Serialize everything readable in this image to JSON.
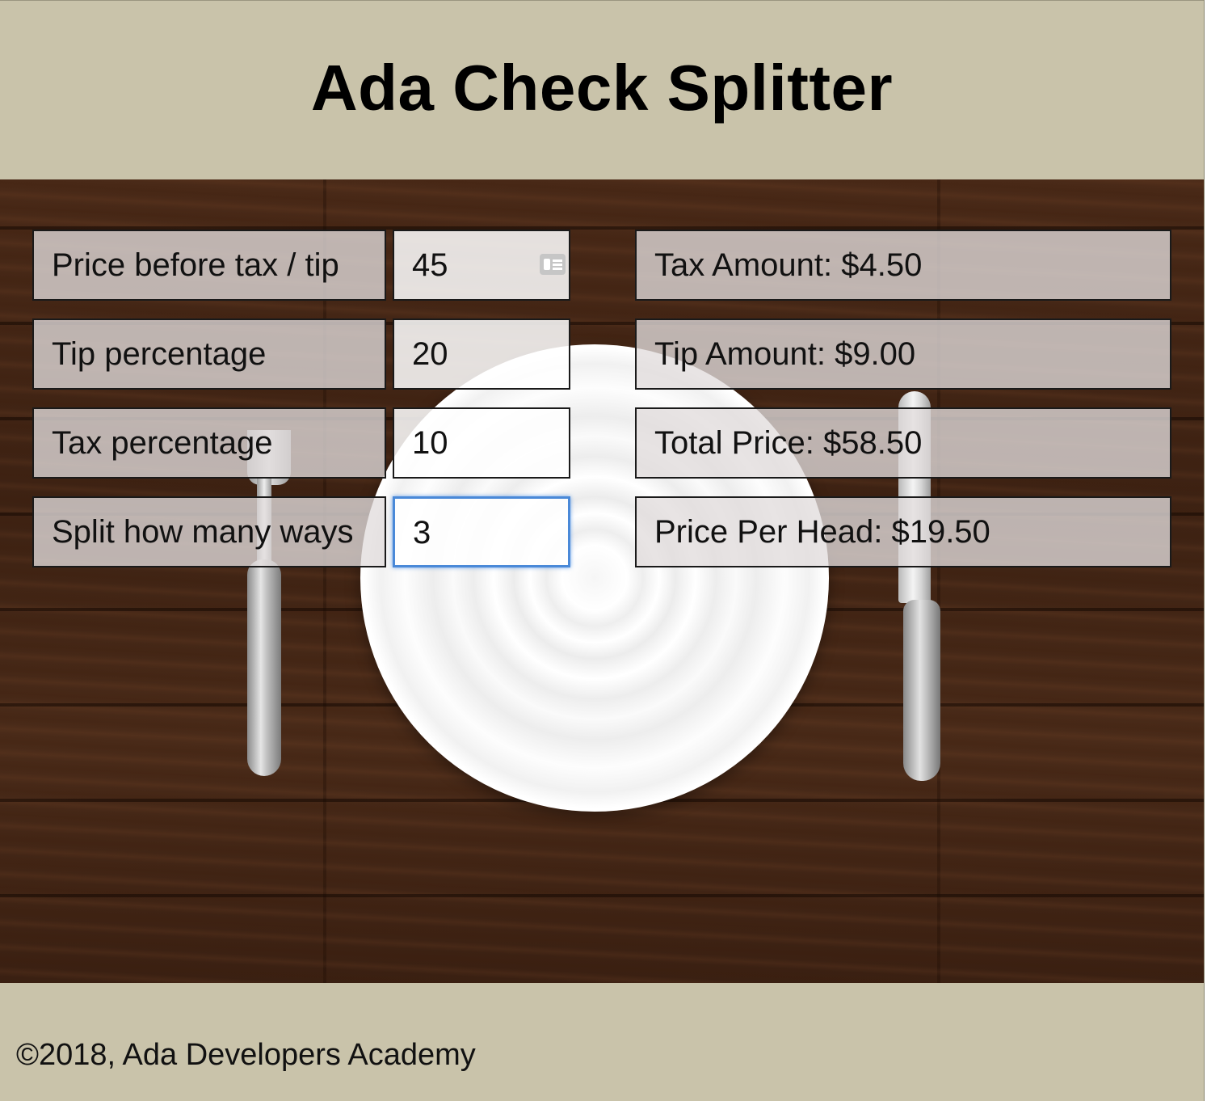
{
  "header": {
    "title": "Ada Check Splitter"
  },
  "form": {
    "price_label": "Price before tax / tip",
    "price_value": "45",
    "tip_label": "Tip percentage",
    "tip_value": "20",
    "tax_label": "Tax percentage",
    "tax_value": "10",
    "split_label": "Split how many ways",
    "split_value": "3"
  },
  "results": {
    "tax_amount": "Tax Amount: $4.50",
    "tip_amount": "Tip Amount: $9.00",
    "total_price": "Total Price: $58.50",
    "price_per_head": "Price Per Head: $19.50"
  },
  "footer": {
    "copyright": "©2018, Ada Developers Academy"
  },
  "colors": {
    "banner": "#c9c3aa",
    "focus_ring": "#4a89d8",
    "table_wood": "#3d2213"
  },
  "icons": {
    "autofill": "contact-card-icon"
  }
}
